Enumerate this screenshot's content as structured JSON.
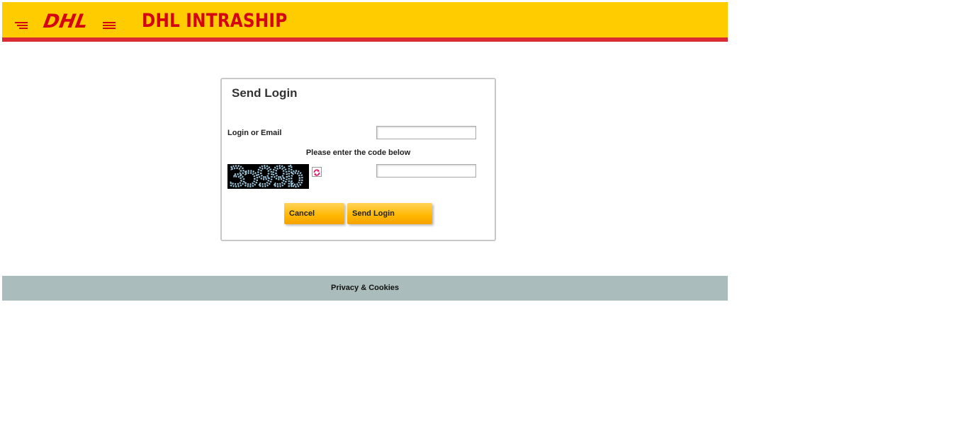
{
  "header": {
    "logo_text": "DHL",
    "app_title": "DHL INTRASHIP"
  },
  "login_panel": {
    "title": "Send Login",
    "login_label": "Login or Email",
    "login_value": "",
    "code_hint": "Please enter the code below",
    "captcha_text": "3ɔ99b",
    "code_value": "",
    "cancel_label": "Cancel",
    "send_label": "Send Login"
  },
  "footer": {
    "link_label": "Privacy & Cookies"
  },
  "colors": {
    "brand_yellow": "#ffcc00",
    "brand_red": "#d40511",
    "footer_bg": "#aabcbb",
    "button_orange": "#ffb700"
  },
  "icons": {
    "refresh": "refresh-icon"
  }
}
